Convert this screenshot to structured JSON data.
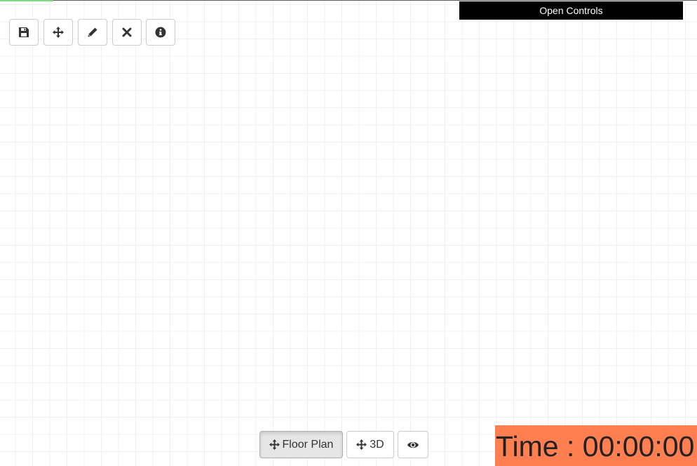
{
  "header": {
    "open_controls_label": "Open Controls"
  },
  "toolbar": {
    "buttons": [
      {
        "name": "save",
        "icon": "floppy-disk-icon"
      },
      {
        "name": "move",
        "icon": "move-arrows-icon"
      },
      {
        "name": "draw",
        "icon": "pencil-icon"
      },
      {
        "name": "delete",
        "icon": "close-x-icon"
      },
      {
        "name": "info",
        "icon": "info-circle-icon"
      }
    ]
  },
  "view_switcher": {
    "floor_plan_label": "Floor Plan",
    "three_d_label": "3D",
    "active": "floor_plan",
    "icons": {
      "floor_plan": "move-arrows-icon",
      "three_d": "move-arrows-icon",
      "preview": "eye-icon"
    }
  },
  "timer": {
    "text": "Time : 00:00:00"
  },
  "colors": {
    "timer_bg": "#ff7f50",
    "header_bg": "#000000",
    "accent_line": "#7fd87f"
  }
}
